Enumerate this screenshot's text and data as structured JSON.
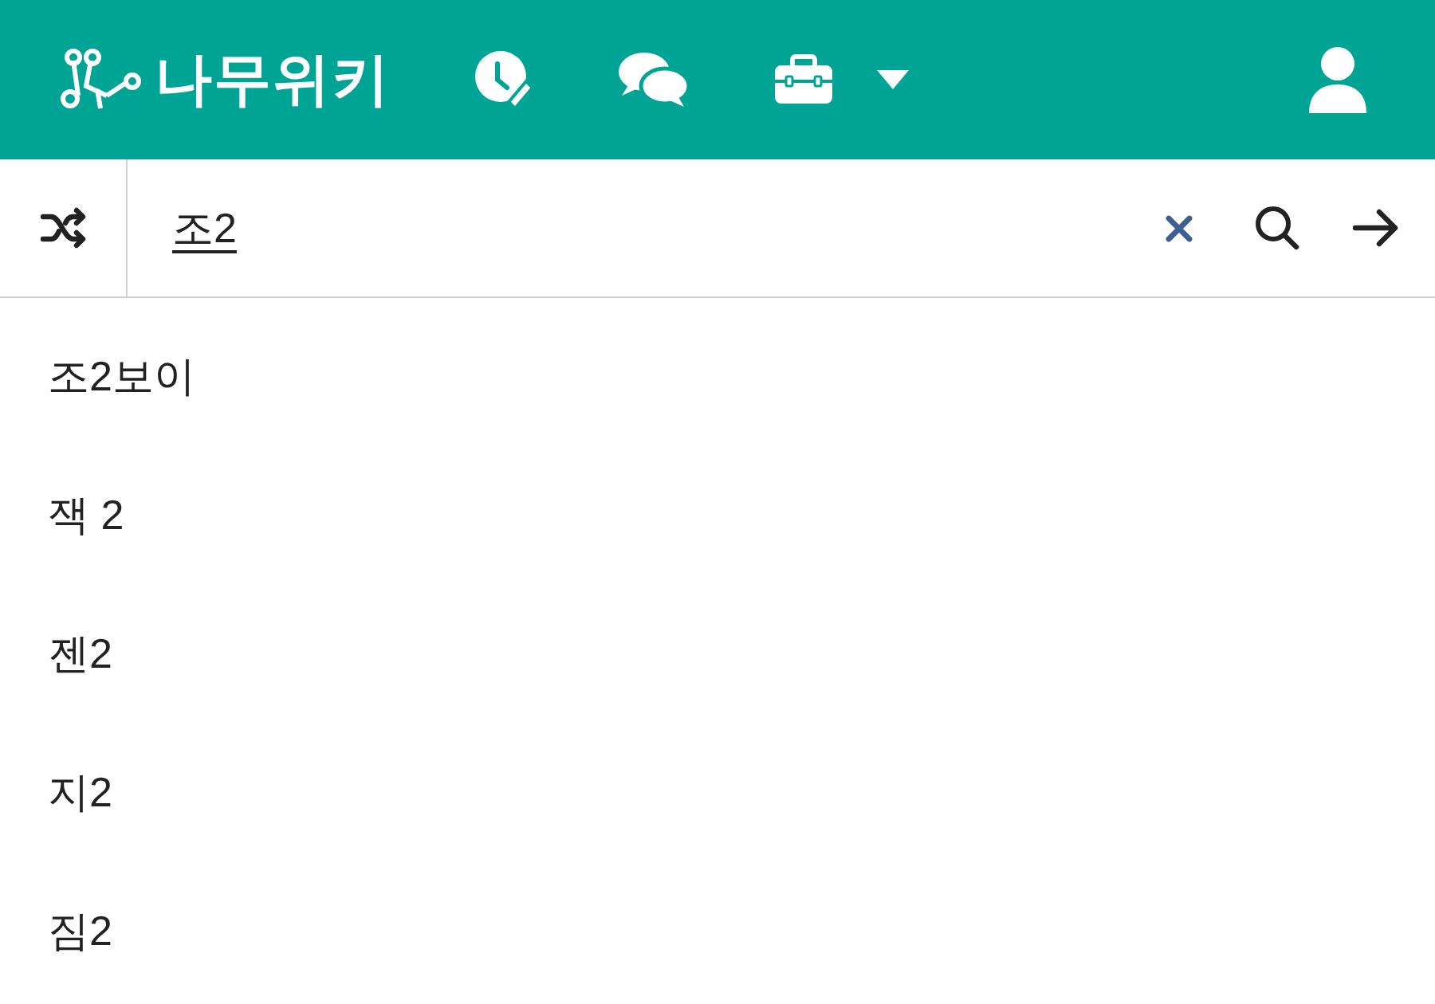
{
  "header": {
    "logo_text": "나무위키"
  },
  "search": {
    "value": "조2"
  },
  "suggestions": [
    {
      "label": "조2보이"
    },
    {
      "label": "잭 2"
    },
    {
      "label": "젠2"
    },
    {
      "label": "지2"
    },
    {
      "label": "짐2"
    }
  ]
}
